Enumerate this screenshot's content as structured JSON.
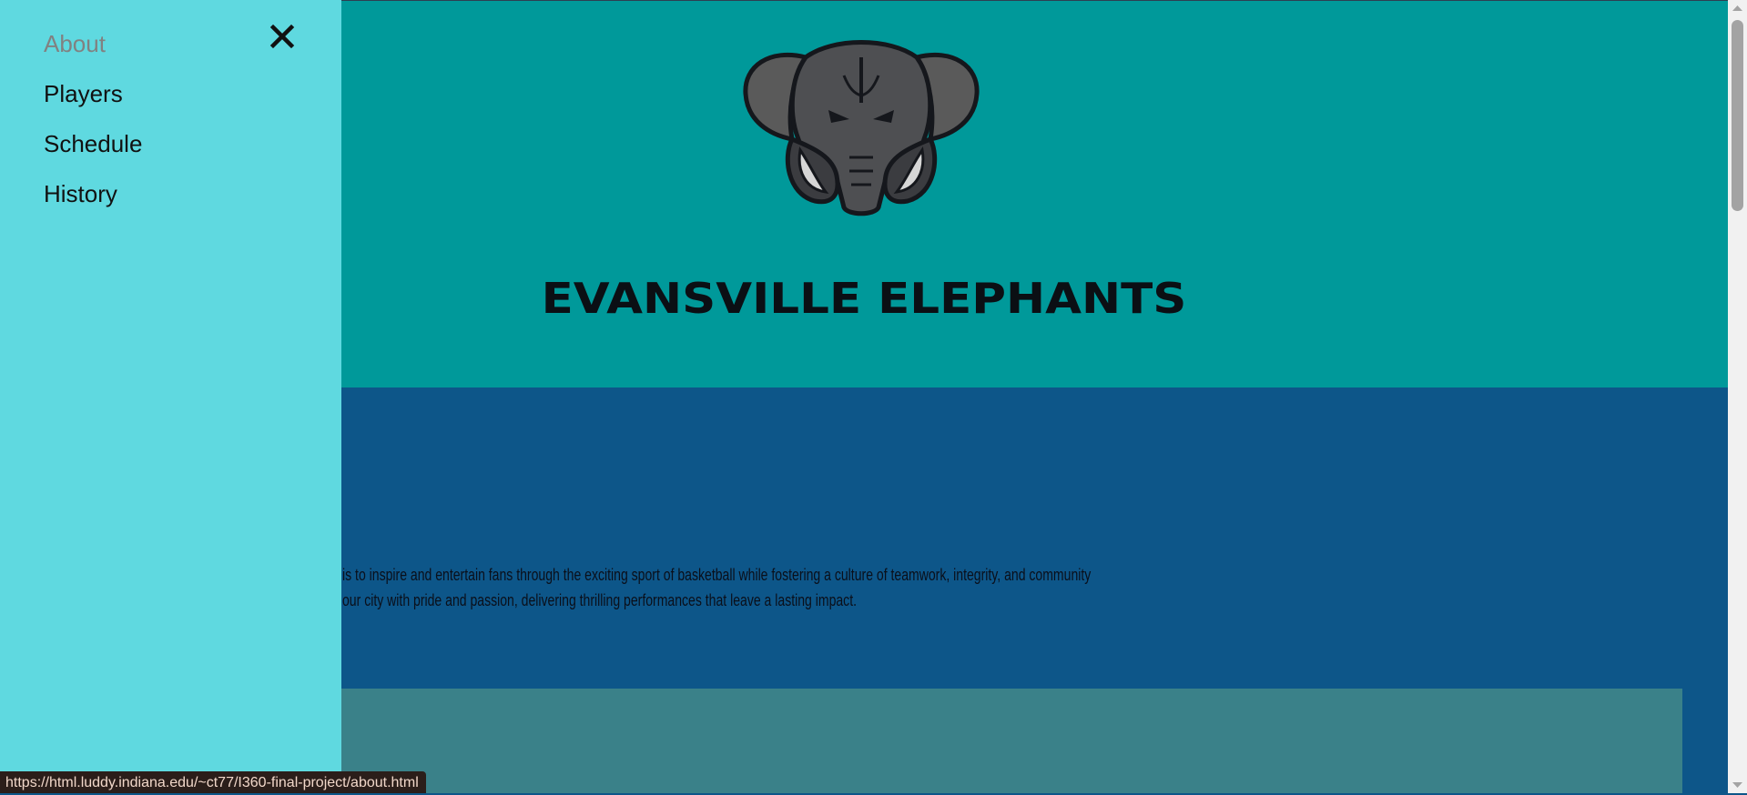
{
  "nav": {
    "items": [
      {
        "label": "About",
        "active": true
      },
      {
        "label": "Players",
        "active": false
      },
      {
        "label": "Schedule",
        "active": false
      },
      {
        "label": "History",
        "active": false
      }
    ],
    "close_icon": "close-icon"
  },
  "hero": {
    "logo_icon": "elephant-logo",
    "title": "EVANSVILLE ELEPHANTS"
  },
  "about": {
    "mission_line1": "is to inspire and entertain fans through the exciting sport of basketball while fostering a culture of teamwork, integrity, and community",
    "mission_line2": "our city with pride and passion, delivering thrilling performances that leave a lasting impact."
  },
  "status_url": "https://html.luddy.indiana.edu/~ct77/I360-final-project/about.html",
  "colors": {
    "hero_bg": "#00999a",
    "about_bg": "#0d5689",
    "sidenav_bg": "#5fd9e0",
    "card_bg": "#3a8189"
  }
}
